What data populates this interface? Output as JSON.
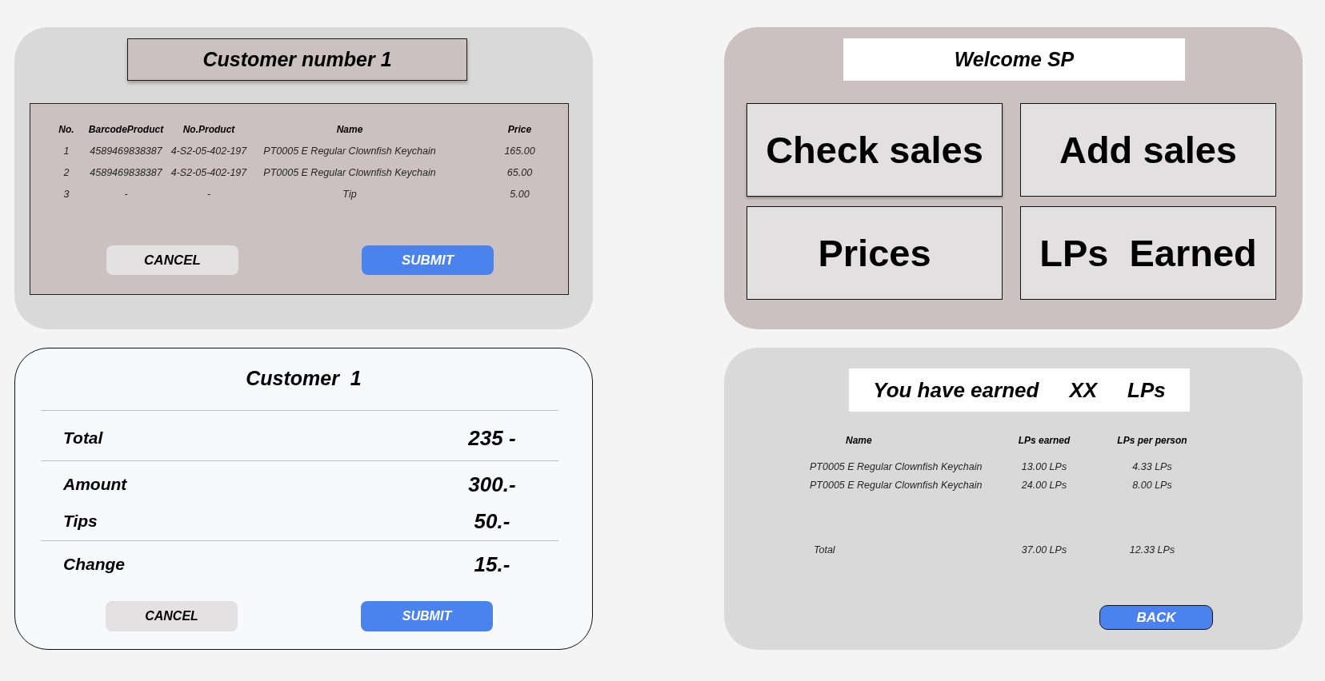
{
  "order_panel": {
    "title": "Customer number 1",
    "table": {
      "columns": [
        "No.",
        "BarcodeProduct",
        "No.Product",
        "Name",
        "Price"
      ],
      "rows": [
        [
          "1",
          "4589469838387",
          "4-S2-05-402-197",
          "PT0005 E Regular Clownfish Keychain",
          "165.00"
        ],
        [
          "2",
          "4589469838387",
          "4-S2-05-402-197",
          "PT0005 E Regular Clownfish Keychain",
          "65.00"
        ],
        [
          "3",
          "-",
          "-",
          "Tip",
          "5.00"
        ]
      ]
    },
    "buttons": [
      {
        "label": "CANCEL",
        "kind": "secondary"
      },
      {
        "label": "SUBMIT",
        "kind": "primary"
      }
    ]
  },
  "menu_panel": {
    "title": "Welcome SP",
    "tiles": [
      "Check sales",
      "Add sales",
      "Prices",
      "LPs  Earned"
    ]
  },
  "payment_panel": {
    "title": "Customer  1",
    "groups": [
      [
        {
          "label": "Total",
          "value": "235 -"
        }
      ],
      [
        {
          "label": "Amount",
          "value": "300.-"
        },
        {
          "label": "Tips",
          "value": "50.-"
        }
      ],
      [
        {
          "label": "Change",
          "value": "15.-"
        }
      ]
    ],
    "buttons": [
      {
        "label": "CANCEL",
        "kind": "secondary"
      },
      {
        "label": "SUBMIT",
        "kind": "primary"
      }
    ]
  },
  "earnings_panel": {
    "headline": [
      "You have earned",
      "XX",
      "LPs"
    ],
    "table": {
      "columns": [
        "Name",
        "LPs earned",
        "LPs per person"
      ],
      "rows": [
        [
          "PT0005 E Regular Clownfish Keychain",
          "13.00 LPs",
          "4.33 LPs"
        ],
        [
          "PT0005 E Regular Clownfish Keychain",
          "24.00 LPs",
          "8.00 LPs"
        ]
      ],
      "total": [
        "Total",
        "37.00 LPs",
        "12.33 LPs"
      ]
    },
    "buttons": [
      {
        "label": "BACK",
        "kind": "outlined"
      }
    ]
  }
}
